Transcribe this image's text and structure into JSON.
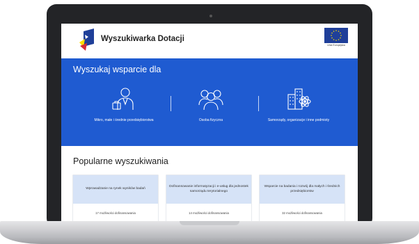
{
  "header": {
    "site_title": "Wyszukiwarka Dotacji",
    "eu_label": "Unia Europejska"
  },
  "search": {
    "title": "Wyszukaj wsparcie dla",
    "categories": [
      {
        "label": "Mikro, małe i średnie przedsiębiorstwa",
        "icon": "businessman-icon"
      },
      {
        "label": "Osoba fizyczna",
        "icon": "people-group-icon"
      },
      {
        "label": "Samorządy, organizacje i inne podmioty",
        "icon": "buildings-icon"
      }
    ]
  },
  "popular": {
    "title": "Popularne wyszukiwania",
    "cards": [
      {
        "title": "Wprowadzanie na rynek wyników badań",
        "count": "17 możliwości dofinansowania"
      },
      {
        "title": "Dofinansowanie informatyzacji i e-usług dla jednostek samorządu terytorialnego",
        "count": "14 możliwości dofinansowania"
      },
      {
        "title": "Wsparcie na badania i rozwój dla małych i średnich przedsiębiorstw",
        "count": "32 możliwości dofinansowania"
      }
    ]
  },
  "colors": {
    "brand_blue": "#1f5bd1",
    "card_top": "#d6e3f7",
    "eu_blue": "#1f3f99",
    "eu_star": "#ffdd00"
  }
}
